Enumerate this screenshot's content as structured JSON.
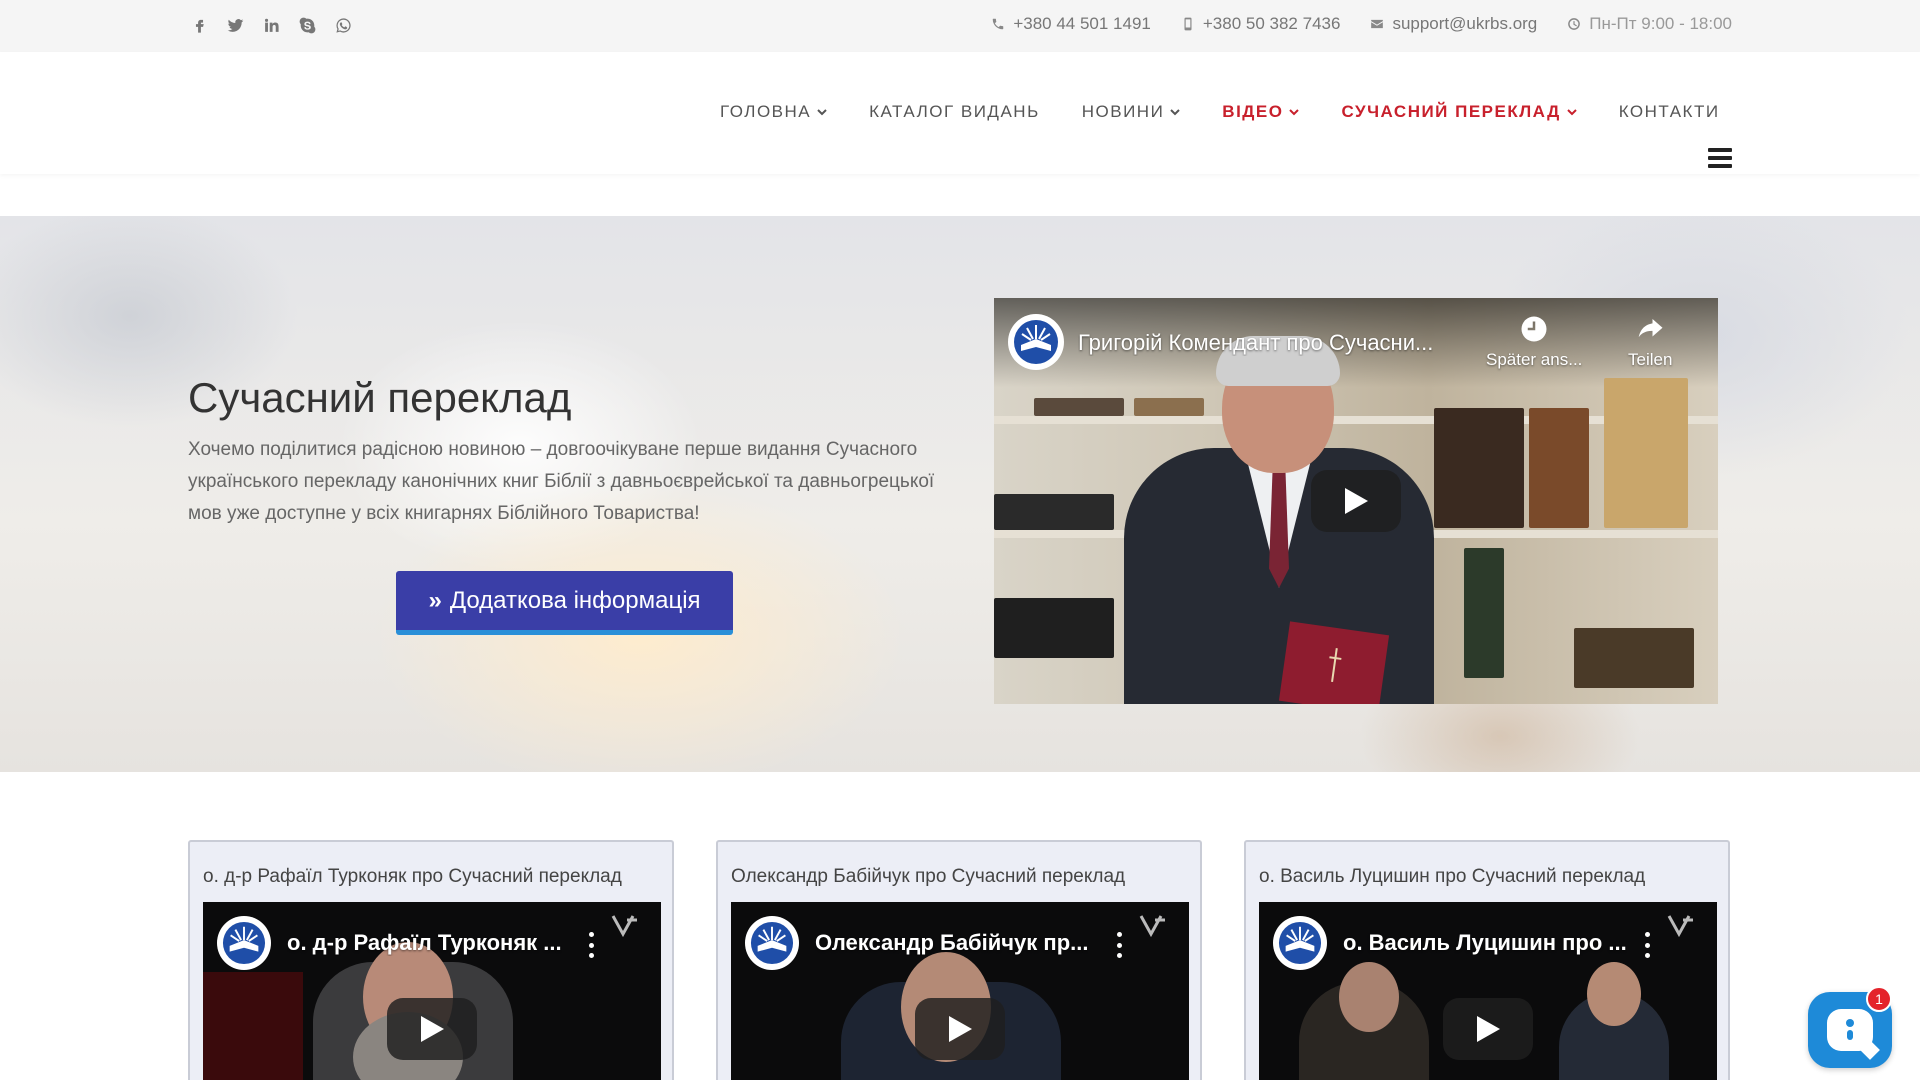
{
  "topbar": {
    "social": [
      "facebook-icon",
      "twitter-icon",
      "linkedin-icon",
      "skype-icon",
      "whatsapp-icon"
    ],
    "phone1": "+380 44 501 1491",
    "phone2": "+380 50 382 7436",
    "email": "support@ukrbs.org",
    "hours": "Пн-Пт 9:00 - 18:00"
  },
  "nav": {
    "items": [
      {
        "label": "ГОЛОВНА",
        "dropdown": true
      },
      {
        "label": "КАТАЛОГ ВИДАНЬ",
        "dropdown": false
      },
      {
        "label": "НОВИНИ",
        "dropdown": true
      },
      {
        "label": "ВІДЕО",
        "dropdown": true
      },
      {
        "label": "СУЧАСНИЙ ПЕРЕКЛАД",
        "dropdown": true
      },
      {
        "label": "КОНТАКТИ",
        "dropdown": false
      }
    ],
    "highlight_color": "#c8202c"
  },
  "hero": {
    "title": "Сучасний переклад",
    "text": "Хочемо поділитися радісною новиною – довгоочікуване перше видання Сучасного українського перекладу канонічних книг Біблії з давньоєврейської та давньогрецької мов уже доступне у всіх книгарнях Біблійного Товариства!",
    "button": "Додаткова інформація",
    "button_color": "#3a3ea7"
  },
  "main_video": {
    "title": "Григорій Комендант про Сучасни...",
    "watch_later": "Später ans...",
    "share": "Teilen"
  },
  "cards": [
    {
      "title": "о. д-р Рафаїл Турконяк про Сучасний переклад",
      "video_title": "о. д-р Рафаїл Турконяк ..."
    },
    {
      "title": "Олександр Бабійчук про Сучасний переклад",
      "video_title": "Олександр Бабійчук пр..."
    },
    {
      "title": "о. Василь Луцишин про Сучасний переклад",
      "video_title": "о. Василь Луцишин про ..."
    }
  ],
  "chat": {
    "badge": "1",
    "color": "#1e8ad8"
  }
}
